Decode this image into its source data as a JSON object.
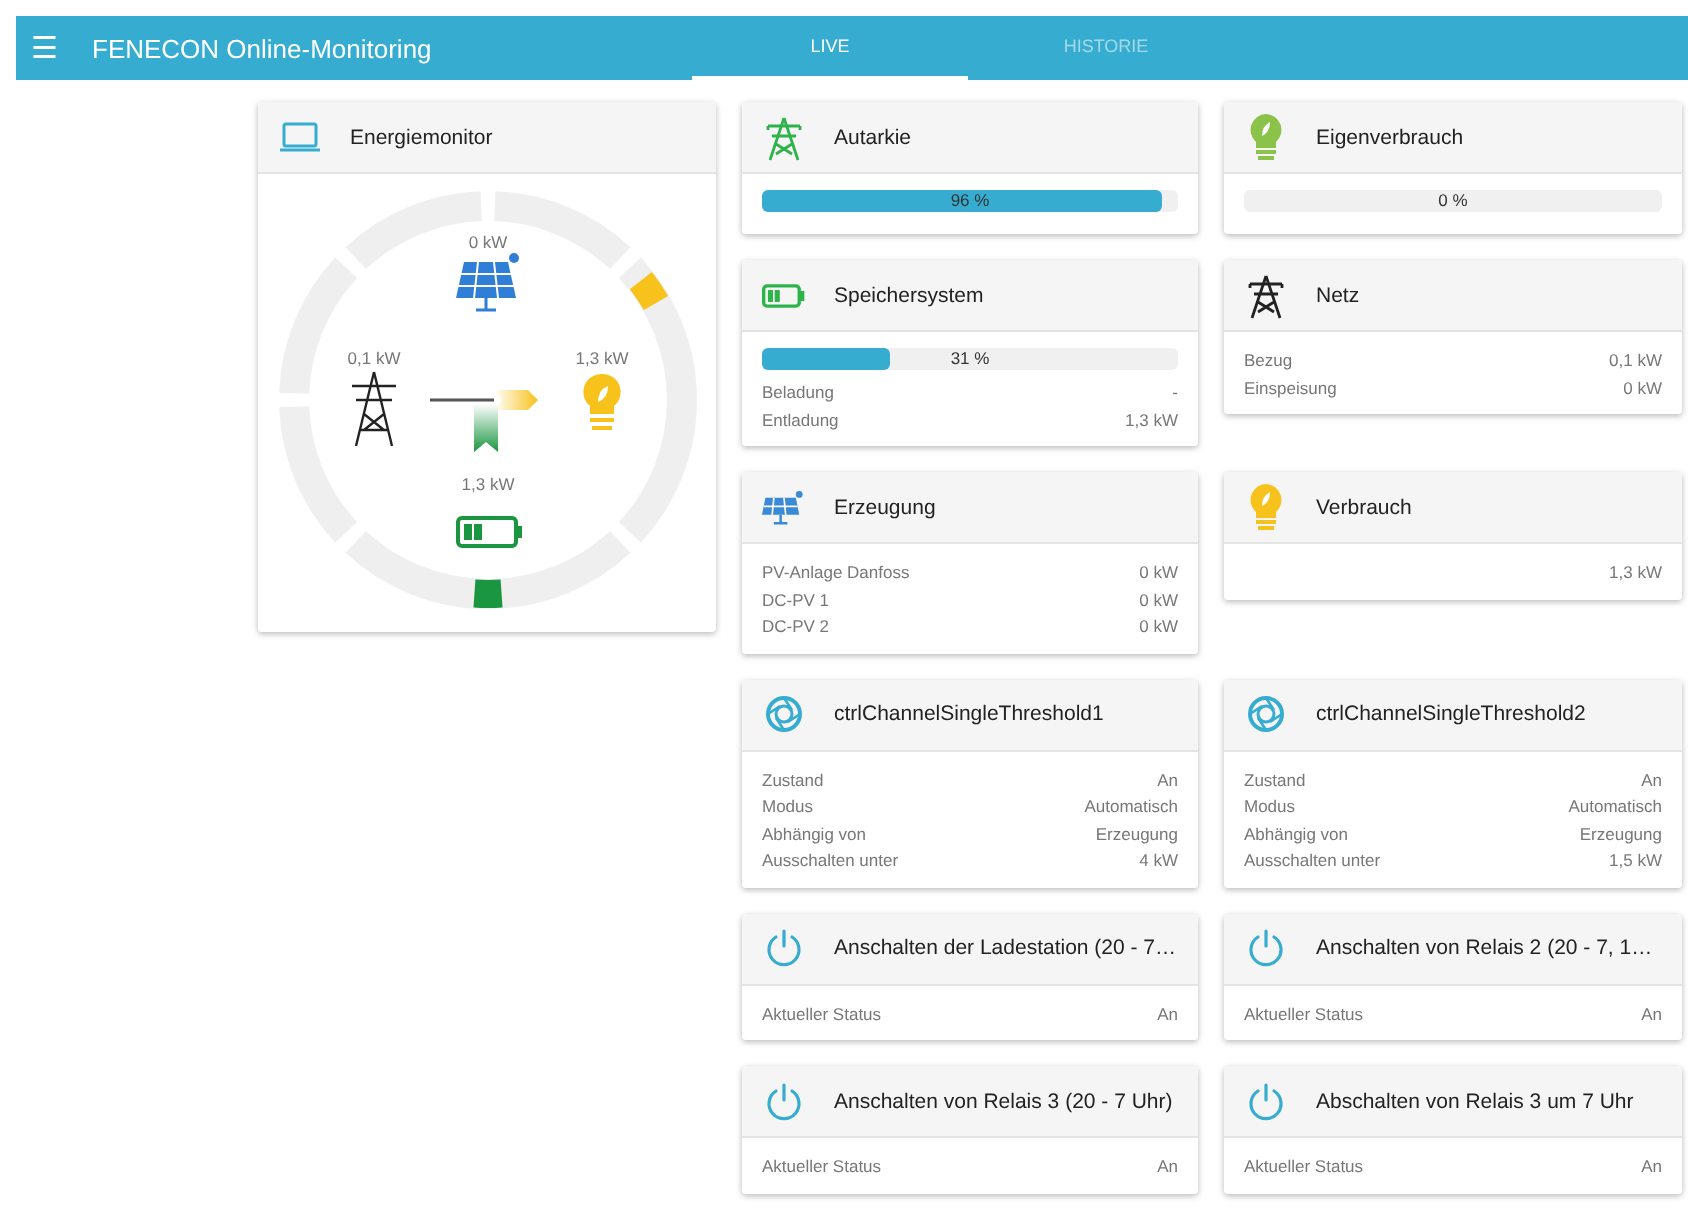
{
  "app_bar": {
    "menu_icon": "☰",
    "title": "FENECON Online-Monitoring"
  },
  "tabs": [
    {
      "label": "LIVE",
      "selected": true
    },
    {
      "label": "HISTORIE",
      "selected": false
    }
  ],
  "energy_monitor": {
    "title": "Energiemonitor",
    "nodes": [
      {
        "kind": "production",
        "value": "0 kW"
      },
      {
        "kind": "grid",
        "value": "0,1 kW"
      },
      {
        "kind": "consumption",
        "value": "1,3 kW"
      },
      {
        "kind": "storage",
        "value": "1,3 kW"
      }
    ]
  },
  "cards": [
    {
      "title": "Autarkie",
      "kind": "autarky",
      "progress": {
        "level": 0.96,
        "label": "96 %"
      }
    },
    {
      "title": "Eigenverbrauch",
      "kind": "self-consumption",
      "progress": {
        "level": 0,
        "label": "0 %"
      }
    },
    {
      "title": "Speichersystem",
      "kind": "storage",
      "progress": {
        "level": 0.31,
        "label": "31 %"
      },
      "rows": [
        {
          "label": "Beladung",
          "value": "-"
        },
        {
          "label": "Entladung",
          "value": "1,3 kW"
        }
      ]
    },
    {
      "title": "Netz",
      "kind": "grid",
      "rows": [
        {
          "label": "Bezug",
          "value": "0,1 kW"
        },
        {
          "label": "Einspeisung",
          "value": "0 kW"
        }
      ]
    },
    {
      "title": "Erzeugung",
      "kind": "production",
      "rows": [
        {
          "label": "PV-Anlage Danfoss",
          "value": "0 kW"
        },
        {
          "label": "DC-PV 1",
          "value": "0 kW"
        },
        {
          "label": "DC-PV 2",
          "value": "0 kW"
        }
      ]
    },
    {
      "title": "Verbrauch",
      "kind": "consumption",
      "value": "1,3 kW"
    },
    {
      "title": "ctrlChannelSingleThreshold1",
      "kind": "threshold",
      "rows": [
        {
          "label": "Zustand",
          "value": "An"
        },
        {
          "label": "Modus",
          "value": "Automatisch"
        },
        {
          "label": "Abhängig von",
          "value": "Erzeugung"
        },
        {
          "label": "Ausschalten unter",
          "value": "4 kW"
        }
      ]
    },
    {
      "title": "ctrlChannelSingleThreshold2",
      "kind": "threshold",
      "rows": [
        {
          "label": "Zustand",
          "value": "An"
        },
        {
          "label": "Modus",
          "value": "Automatisch"
        },
        {
          "label": "Abhängig von",
          "value": "Erzeugung"
        },
        {
          "label": "Ausschalten unter",
          "value": "1,5 kW"
        }
      ]
    },
    {
      "title": "Anschalten der Ladestation (20 - 7…",
      "kind": "switch",
      "rows": [
        {
          "label": "Aktueller Status",
          "value": "An"
        }
      ]
    },
    {
      "title": "Anschalten von Relais 2 (20 - 7, 1…",
      "kind": "switch",
      "rows": [
        {
          "label": "Aktueller Status",
          "value": "An"
        }
      ]
    },
    {
      "title": "Anschalten von Relais 3 (20 - 7 Uhr)",
      "kind": "switch",
      "rows": [
        {
          "label": "Aktueller Status",
          "value": "An"
        }
      ]
    },
    {
      "title": "Abschalten von Relais 3 um 7 Uhr",
      "kind": "switch",
      "rows": [
        {
          "label": "Aktueller Status",
          "value": "An"
        }
      ]
    }
  ]
}
